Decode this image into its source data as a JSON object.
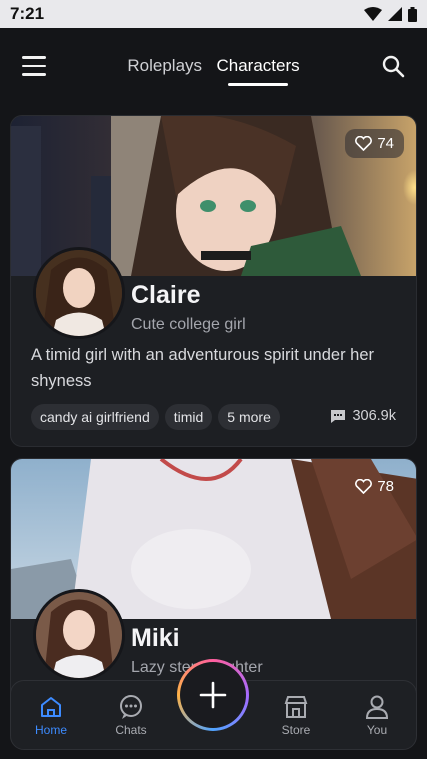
{
  "status_bar": {
    "time": "7:21"
  },
  "header": {
    "tabs": [
      {
        "label": "Roleplays",
        "active": false
      },
      {
        "label": "Characters",
        "active": true
      }
    ]
  },
  "cards": [
    {
      "likes": "74",
      "name": "Claire",
      "tagline": "Cute college girl",
      "description": "A timid girl with an adventurous spirit under her shyness",
      "tags": [
        "candy ai girlfriend",
        "timid",
        "5 more"
      ],
      "chat_count": "306.9k"
    },
    {
      "likes": "78",
      "name": "Miki",
      "tagline": "Lazy stepdaughter"
    }
  ],
  "bottom_nav": {
    "items": [
      {
        "label": "Home",
        "icon": "home-icon",
        "active": true
      },
      {
        "label": "Chats",
        "icon": "chat-bubble-icon",
        "active": false
      },
      {
        "label": "Store",
        "icon": "store-icon",
        "active": false
      },
      {
        "label": "You",
        "icon": "person-icon",
        "active": false
      }
    ],
    "fab_icon": "plus-icon"
  },
  "colors": {
    "background": "#141518",
    "card": "#1d1f23",
    "accent": "#3d8bff",
    "tag": "#2d2f34"
  }
}
